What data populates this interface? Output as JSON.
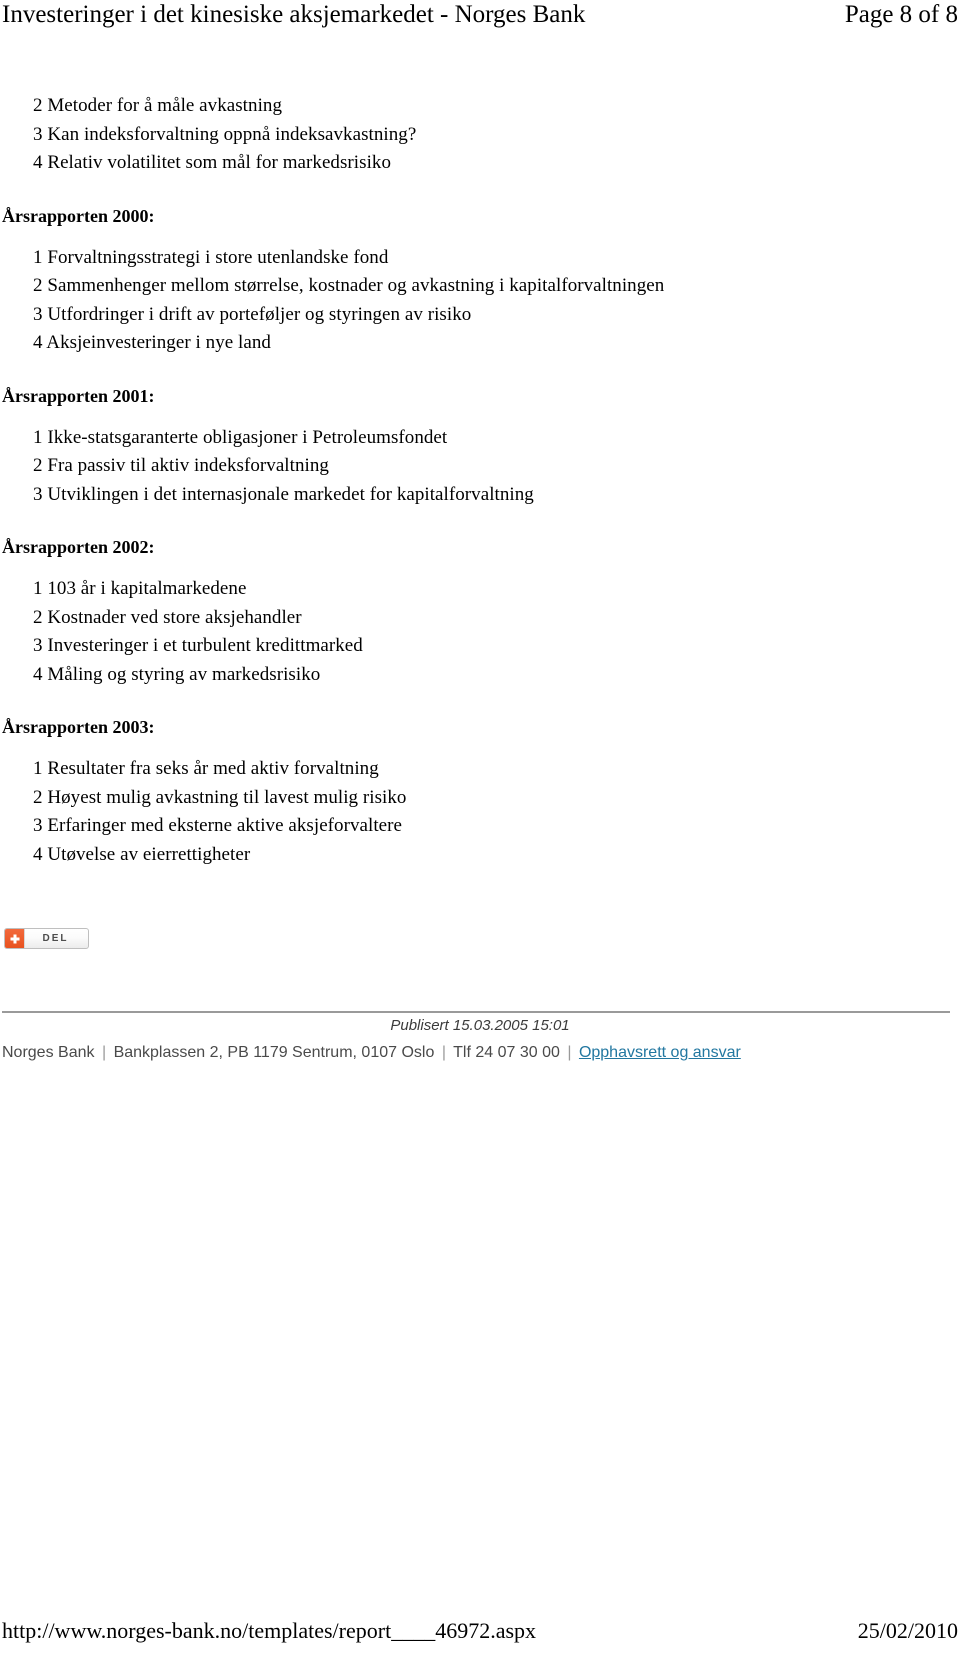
{
  "print_header": {
    "title": "Investeringer i det kinesiske aksjemarkedet - Norges Bank",
    "page_indicator": "Page 8 of 8"
  },
  "content": {
    "leading_items": [
      "2 Metoder for å måle avkastning",
      "3 Kan indeksforvaltning oppnå indeksavkastning?",
      "4 Relativ volatilitet som mål for markedsrisiko"
    ],
    "sections": [
      {
        "heading": "Årsrapporten 2000:",
        "items": [
          "1 Forvaltningsstrategi i store utenlandske fond",
          "2 Sammenhenger mellom størrelse, kostnader og avkastning i kapitalforvaltningen",
          "3 Utfordringer i drift av porteføljer og styringen av risiko",
          "4 Aksjeinvesteringer i nye land"
        ]
      },
      {
        "heading": "Årsrapporten 2001:",
        "items": [
          "1 Ikke-statsgaranterte obligasjoner i Petroleumsfondet",
          "2 Fra passiv til aktiv indeksforvaltning",
          "3 Utviklingen i det internasjonale markedet for kapitalforvaltning"
        ]
      },
      {
        "heading": "Årsrapporten 2002:",
        "items": [
          "1 103 år i kapitalmarkedene",
          "2 Kostnader ved store aksjehandler",
          "3 Investeringer i et turbulent kredittmarked",
          "4 Måling og styring av markedsrisiko"
        ]
      },
      {
        "heading": "Årsrapporten 2003:",
        "items": [
          "1 Resultater fra seks år med aktiv forvaltning",
          "2 Høyest mulig avkastning til lavest mulig risiko",
          "3 Erfaringer med eksterne aktive aksjeforvaltere",
          "4 Utøvelse av eierrettigheter"
        ]
      }
    ]
  },
  "share_button": {
    "label": "DEL",
    "icon": "plus-icon",
    "icon_color": "#e8521f"
  },
  "footer": {
    "published": "Publisert 15.03.2005 15:01",
    "org": "Norges Bank",
    "address": "Bankplassen 2, PB 1179 Sentrum, 0107 Oslo",
    "phone": "Tlf 24 07 30 00",
    "link_label": "Opphavsrett og ansvar",
    "separator": "|",
    "link_color": "#2277a0",
    "rule_color": "#9a9a9a"
  },
  "print_footer": {
    "url": "http://www.norges-bank.no/templates/report____46972.aspx",
    "date": "25/02/2010"
  }
}
